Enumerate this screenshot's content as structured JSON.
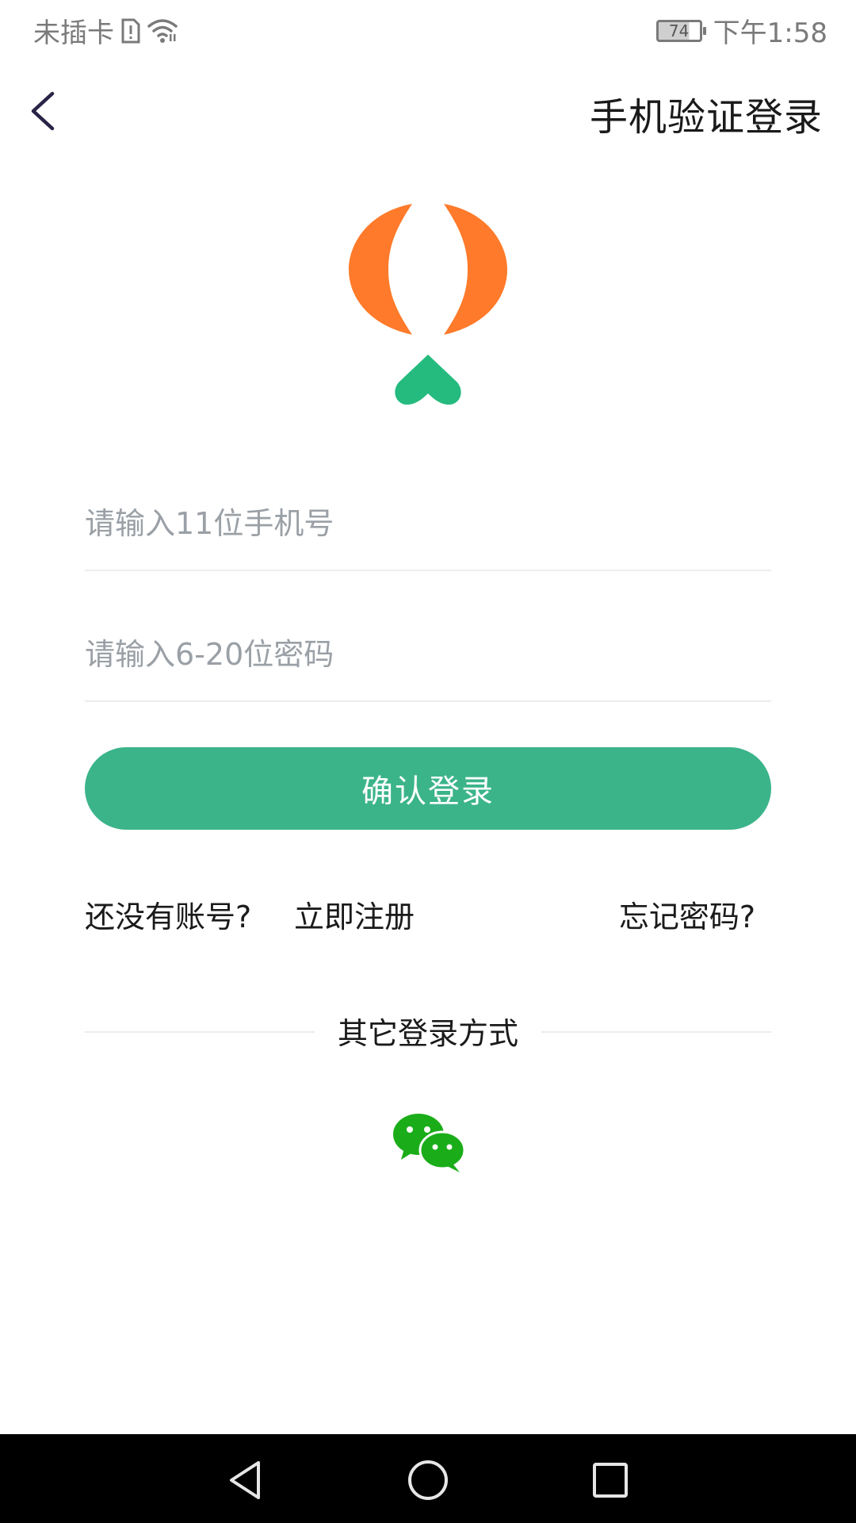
{
  "status_bar": {
    "carrier": "未插卡",
    "battery_level": "74",
    "time": "下午1:58",
    "icons": [
      "sim-alert-icon",
      "wifi-icon",
      "battery-icon"
    ]
  },
  "header": {
    "title": "手机验证登录",
    "back_icon": "chevron-left-icon"
  },
  "logo": {
    "icon": "app-logo-icon",
    "colors": {
      "orange": "#ff7a2a",
      "green": "#26bb7e"
    }
  },
  "form": {
    "phone_placeholder": "请输入11位手机号",
    "phone_value": "",
    "password_placeholder": "请输入6-20位密码",
    "password_value": "",
    "submit_label": "确认登录"
  },
  "links": {
    "no_account": "还没有账号?",
    "register": "立即注册",
    "forgot_password": "忘记密码?"
  },
  "other_login": {
    "label": "其它登录方式",
    "wechat_icon": "wechat-icon",
    "wechat_color": "#1aad19"
  },
  "colors": {
    "accent": "#3bb48a",
    "text": "#1a1a1a",
    "placeholder": "#9aa0a6",
    "divider": "#ececec"
  },
  "nav_bar": {
    "icons": [
      "nav-back-icon",
      "nav-home-icon",
      "nav-recent-icon"
    ]
  }
}
